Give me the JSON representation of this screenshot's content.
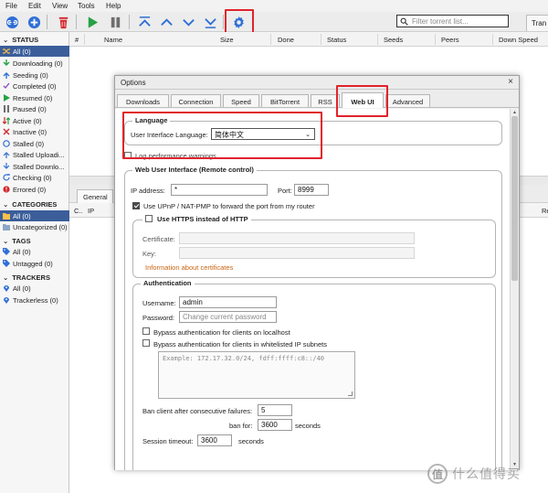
{
  "menu": [
    "File",
    "Edit",
    "View",
    "Tools",
    "Help"
  ],
  "toolbar": {
    "search_placeholder": "Filter torrent list...",
    "transfers_tab": "Tran"
  },
  "sidebar": {
    "status": {
      "title": "STATUS",
      "items": [
        "All (0)",
        "Downloading (0)",
        "Seeding (0)",
        "Completed (0)",
        "Resumed (0)",
        "Paused (0)",
        "Active (0)",
        "Inactive (0)",
        "Stalled (0)",
        "Stalled Uploadi...",
        "Stalled Downlo...",
        "Checking (0)",
        "Errored (0)"
      ]
    },
    "categories": {
      "title": "CATEGORIES",
      "items": [
        "All (0)",
        "Uncategorized (0)"
      ]
    },
    "tags": {
      "title": "TAGS",
      "items": [
        "All (0)",
        "Untagged (0)"
      ]
    },
    "trackers": {
      "title": "TRACKERS",
      "items": [
        "All (0)",
        "Trackerless (0)"
      ]
    }
  },
  "torrent_table": {
    "columns": [
      "#",
      "Name",
      "Size",
      "Done",
      "Status",
      "Seeds",
      "Peers",
      "Down Speed"
    ]
  },
  "lower_panel": {
    "tab": "General",
    "columns": [
      "C..",
      "IP",
      "Re"
    ]
  },
  "options_dialog": {
    "title": "Options",
    "close": "×",
    "tabs": [
      "Downloads",
      "Connection",
      "Speed",
      "BitTorrent",
      "RSS",
      "Web UI",
      "Advanced"
    ],
    "active_tab": "Web UI",
    "language": {
      "legend": "Language",
      "label": "User Interface Language:",
      "value": "简体中文"
    },
    "log_warnings": "Log performance warnings",
    "webui": {
      "legend": "Web User Interface (Remote control)",
      "ip_label": "IP address:",
      "ip_value": "*",
      "port_label": "Port:",
      "port_value": "8999",
      "upnp_label": "Use UPnP / NAT-PMP to forward the port from my router",
      "upnp_checked": true
    },
    "https": {
      "legend": "Use HTTPS instead of HTTP",
      "checked": false,
      "certificate_label": "Certificate:",
      "key_label": "Key:",
      "info_link": "Information about certificates"
    },
    "auth": {
      "legend": "Authentication",
      "username_label": "Username:",
      "username_value": "admin",
      "password_label": "Password:",
      "password_placeholder": "Change current password",
      "bypass_localhost": "Bypass authentication for clients on localhost",
      "bypass_whitelist": "Bypass authentication for clients in whitelisted IP subnets",
      "subnets_placeholder": "Example: 172.17.32.0/24, fdff:ffff:c8::/40",
      "ban_label": "Ban client after consecutive failures:",
      "ban_value": "5",
      "ban_for_label": "ban for:",
      "ban_for_value": "3600",
      "ban_for_unit": "seconds",
      "timeout_label": "Session timeout:",
      "timeout_value": "3600",
      "timeout_unit": "seconds"
    }
  },
  "watermark": {
    "glyph": "值",
    "text": "什么值得买"
  },
  "colors": {
    "selected_bg": "#3b5e9a",
    "highlight_red": "#e0232c",
    "link_orange": "#c8640f"
  }
}
